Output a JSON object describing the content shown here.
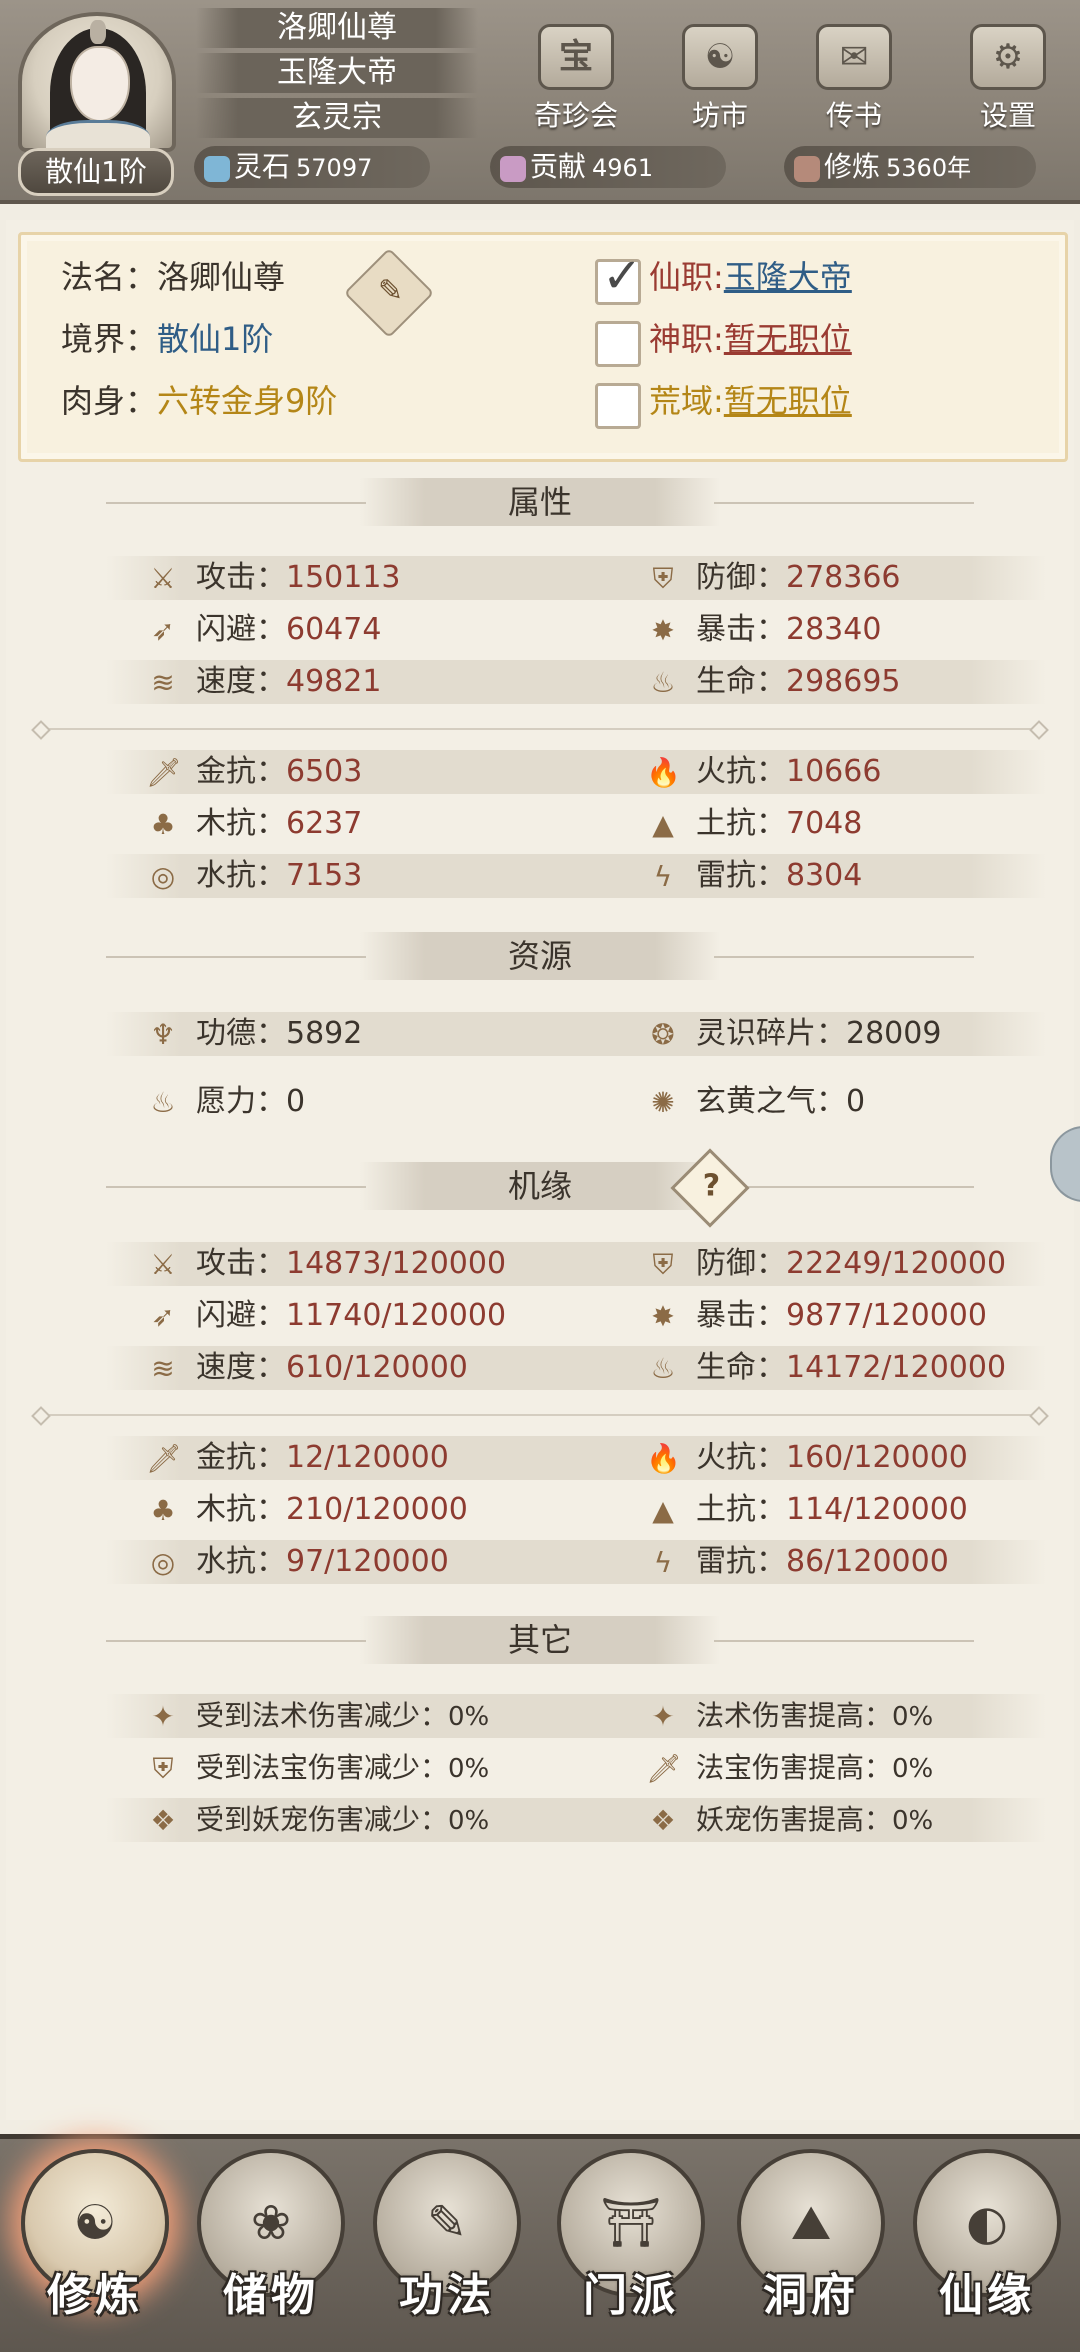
{
  "header": {
    "rank_badge": "散仙1阶",
    "titles": [
      "洛卿仙尊",
      "玉隆大帝",
      "玄灵宗"
    ],
    "buttons": [
      {
        "label": "奇珍会",
        "icon": "treasure-pavilion-icon",
        "glyph": "宝"
      },
      {
        "label": "坊市",
        "icon": "market-icon",
        "glyph": "☯"
      },
      {
        "label": "传书",
        "icon": "scroll-letter-icon",
        "glyph": "✉"
      },
      {
        "label": "设置",
        "icon": "gear-icon",
        "glyph": "⚙"
      }
    ],
    "resources": [
      {
        "name": "灵石",
        "value": "57097",
        "icon": "spirit-stone-icon",
        "color": "#7fb6d6"
      },
      {
        "name": "贡献",
        "value": "4961",
        "icon": "contribution-icon",
        "color": "#c99bc4"
      },
      {
        "name": "修炼",
        "value": "5360年",
        "icon": "cultivation-icon",
        "color": "#b58a7a"
      }
    ]
  },
  "profile": {
    "dharma_name_label": "法名：",
    "dharma_name": "洛卿仙尊",
    "realm_label": "境界：",
    "realm": "散仙1阶",
    "body_label": "肉身：",
    "body": "六转金身9阶",
    "immortal_post_label": "仙职",
    "immortal_post": "玉隆大帝",
    "immortal_post_checked": true,
    "divine_post_label": "神职",
    "divine_post": "暂无职位",
    "divine_post_checked": false,
    "wild_domain_label": "荒域",
    "wild_domain": "暂无职位",
    "wild_domain_checked": false
  },
  "sections": {
    "attributes": "属性",
    "resources": "资源",
    "fortune": "机缘",
    "others": "其它"
  },
  "attributes": {
    "attack_label": "攻击：",
    "attack": "150113",
    "defense_label": "防御：",
    "defense": "278366",
    "dodge_label": "闪避：",
    "dodge": "60474",
    "crit_label": "暴击：",
    "crit": "28340",
    "speed_label": "速度：",
    "speed": "49821",
    "life_label": "生命：",
    "life": "298695",
    "metal_res_label": "金抗：",
    "metal_res": "6503",
    "fire_res_label": "火抗：",
    "fire_res": "10666",
    "wood_res_label": "木抗：",
    "wood_res": "6237",
    "earth_res_label": "土抗：",
    "earth_res": "7048",
    "water_res_label": "水抗：",
    "water_res": "7153",
    "thunder_res_label": "雷抗：",
    "thunder_res": "8304"
  },
  "resources": {
    "merit_label": "功德：",
    "merit": "5892",
    "shard_label": "灵识碎片：",
    "shard": "28009",
    "wish_label": "愿力：",
    "wish": "0",
    "xuanhuang_label": "玄黄之气：",
    "xuanhuang": "0"
  },
  "fortune": {
    "attack": "14873/120000",
    "defense": "22249/120000",
    "dodge": "11740/120000",
    "crit": "9877/120000",
    "speed": "610/120000",
    "life": "14172/120000",
    "metal_res": "12/120000",
    "fire_res": "160/120000",
    "wood_res": "210/120000",
    "earth_res": "114/120000",
    "water_res": "97/120000",
    "thunder_res": "86/120000"
  },
  "others": {
    "spell_dmg_reduce_label": "受到法术伤害减少：",
    "spell_dmg_reduce": "0%",
    "spell_dmg_up_label": "法术伤害提高：",
    "spell_dmg_up": "0%",
    "treasure_dmg_reduce_label": "受到法宝伤害减少：",
    "treasure_dmg_reduce": "0%",
    "treasure_dmg_up_label": "法宝伤害提高：",
    "treasure_dmg_up": "0%",
    "pet_dmg_reduce_label": "受到妖宠伤害减少：",
    "pet_dmg_reduce": "0%",
    "pet_dmg_up_label": "妖宠伤害提高：",
    "pet_dmg_up": "0%"
  },
  "nav": [
    {
      "label": "修炼",
      "icon": "cultivation-nav-icon",
      "active": true
    },
    {
      "label": "储物",
      "icon": "storage-bag-icon",
      "active": false
    },
    {
      "label": "功法",
      "icon": "scripture-scroll-icon",
      "active": false
    },
    {
      "label": "门派",
      "icon": "sect-gate-icon",
      "active": false
    },
    {
      "label": "洞府",
      "icon": "cave-dwelling-icon",
      "active": false
    },
    {
      "label": "仙缘",
      "icon": "immortal-fate-icon",
      "active": false
    }
  ],
  "colors": {
    "value_red": "#8d3b30",
    "link_blue": "#2f5d86",
    "gold": "#b48617",
    "accent_red": "#9a3b32"
  }
}
